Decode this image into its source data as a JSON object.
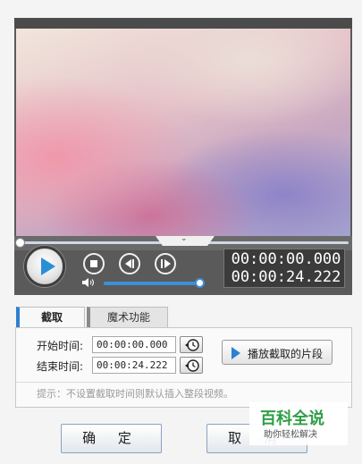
{
  "player": {
    "current_time": "00:00:00.000",
    "total_time": "00:00:24.222",
    "playback_progress": 0.0,
    "volume_level": 1.0
  },
  "tabs": [
    {
      "label": "截取",
      "active": true
    },
    {
      "label": "魔术功能",
      "active": false
    }
  ],
  "clip": {
    "start_label": "开始时间:",
    "start_value": "00:00:00.000",
    "end_label": "结束时间:",
    "end_value": "00:00:24.222",
    "play_clip_label": "播放截取的片段",
    "hint": "提示：不设置截取时间则默认插入整段视频。"
  },
  "buttons": {
    "ok_label": "确 定",
    "cancel_label": "取 消"
  },
  "watermark": {
    "title": "百科全说",
    "subtitle": "助你轻松解决"
  },
  "colors": {
    "accent": "#2b8fd6",
    "watermark_green": "#2d9e45"
  }
}
